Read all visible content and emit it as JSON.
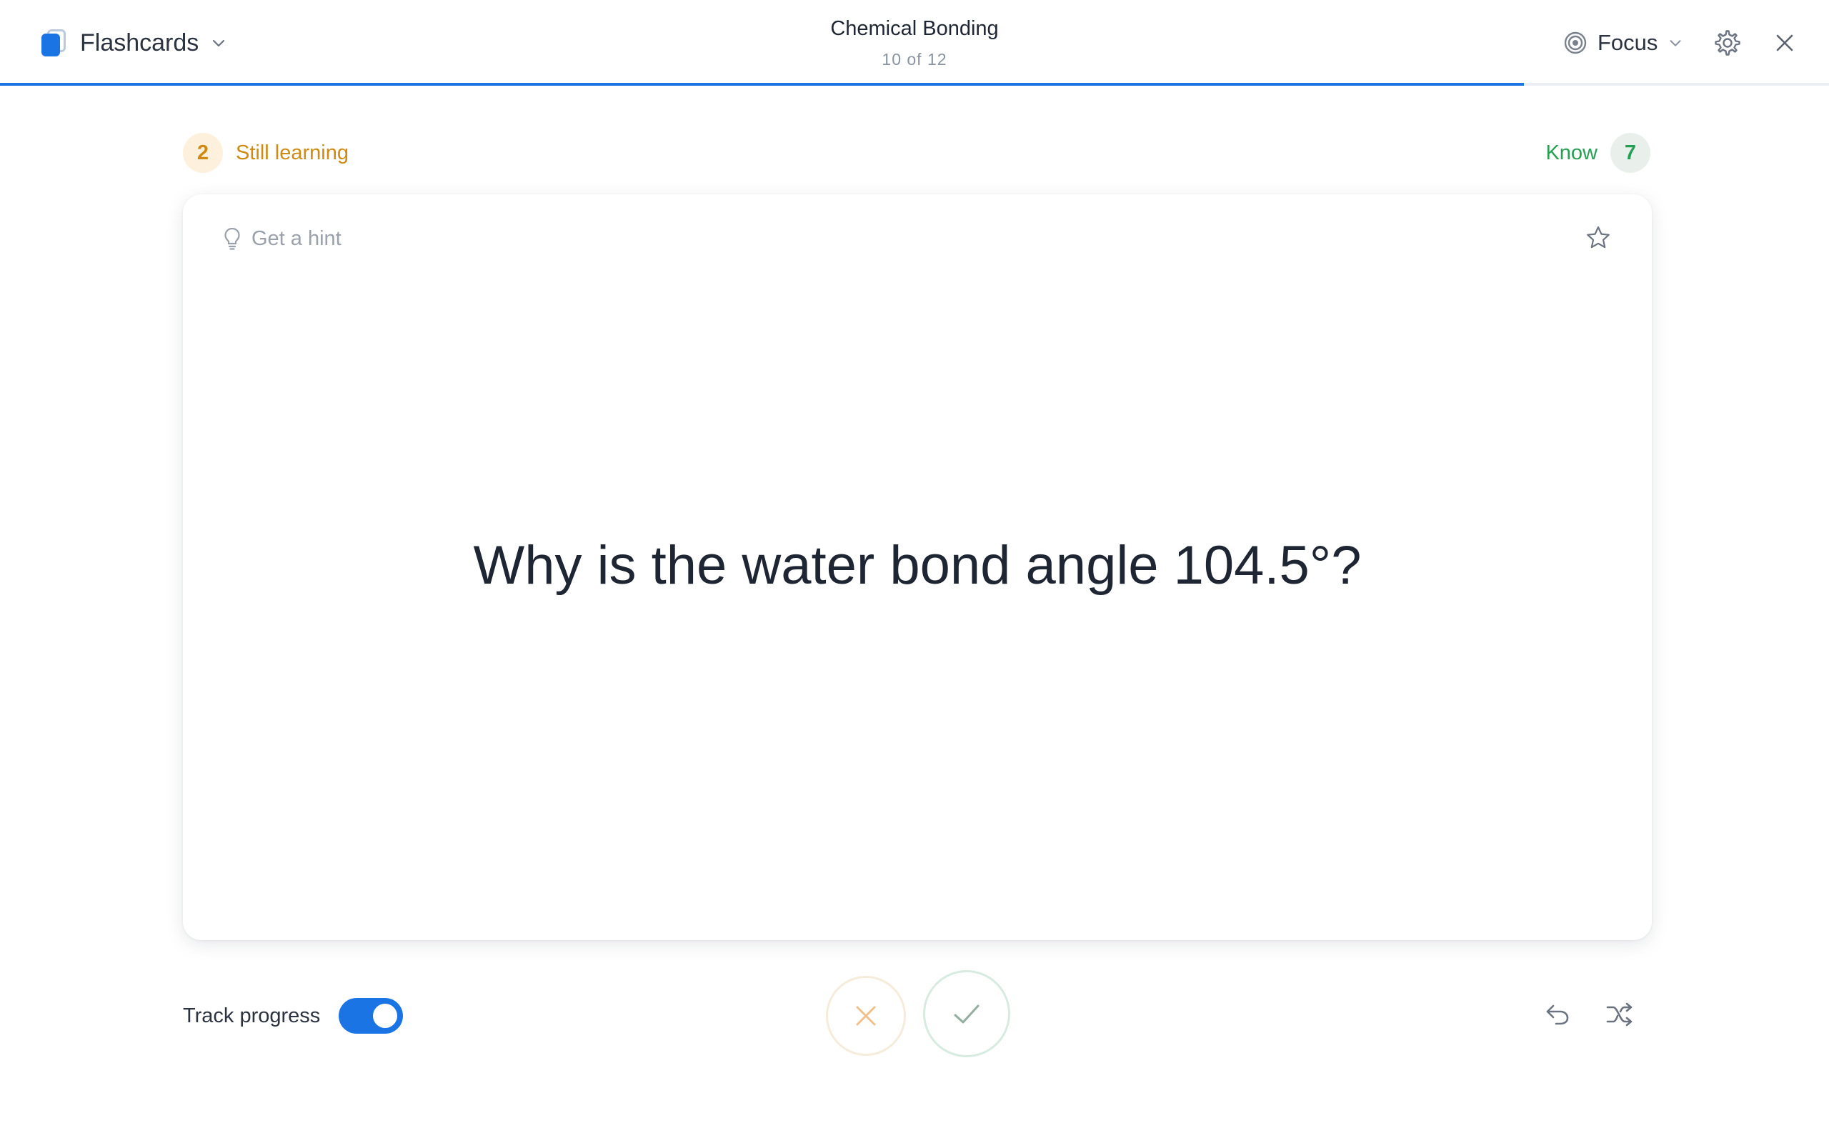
{
  "header": {
    "app_name": "Flashcards",
    "deck_title": "Chemical Bonding",
    "card_position": "10 of 12",
    "progress_fraction": 0.8333,
    "focus_label": "Focus"
  },
  "score": {
    "still_learning_count": "2",
    "still_learning_label": "Still learning",
    "know_label": "Know",
    "know_count": "7"
  },
  "card": {
    "hint_label": "Get a hint",
    "question": "Why is the water bond angle 104.5°?"
  },
  "footer": {
    "track_progress_label": "Track progress",
    "track_progress_on": true
  },
  "colors": {
    "accent": "#1b74e4",
    "still_learning": "#d08a12",
    "know": "#25a053"
  },
  "icons": [
    "flashcards-app-icon",
    "chevron-down-icon",
    "focus-target-icon",
    "gear-icon",
    "close-icon",
    "lightbulb-icon",
    "star-icon",
    "x-icon",
    "check-icon",
    "undo-icon",
    "shuffle-icon"
  ]
}
